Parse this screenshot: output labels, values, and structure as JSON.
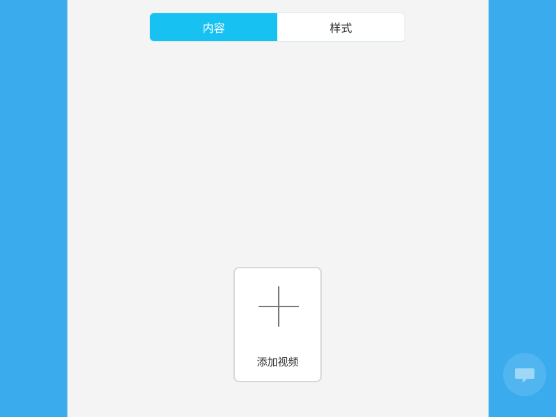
{
  "segmented_control": {
    "tabs": [
      {
        "label": "内容",
        "active": true
      },
      {
        "label": "样式",
        "active": false
      }
    ]
  },
  "add_video": {
    "label": "添加视频"
  },
  "icons": {
    "add": "plus-icon",
    "floating": "chat-bubble-icon"
  },
  "colors": {
    "background": "#3aacee",
    "panel": "#f4f4f4",
    "accent": "#17c2f3",
    "text": "#333333"
  }
}
